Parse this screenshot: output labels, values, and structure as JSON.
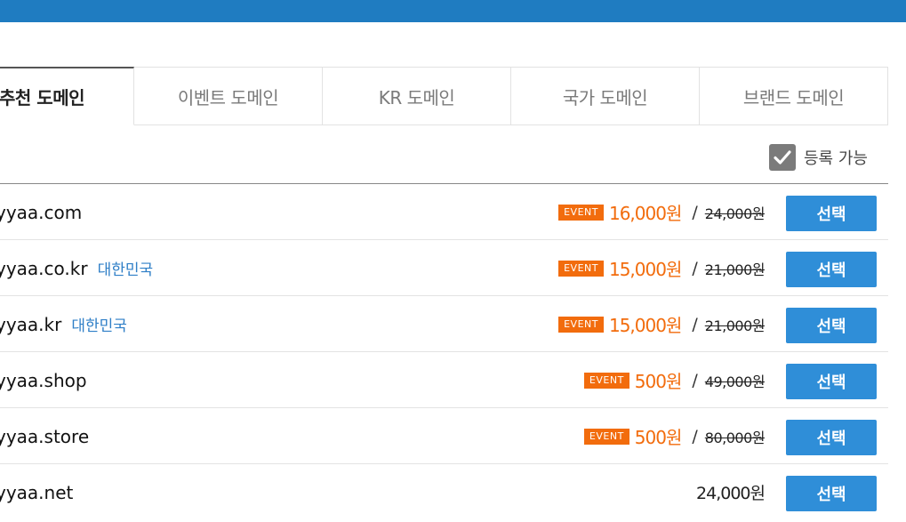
{
  "tabs": [
    {
      "label": "추천 도메인"
    },
    {
      "label": "이벤트 도메인"
    },
    {
      "label": "KR 도메인"
    },
    {
      "label": "국가 도메인"
    },
    {
      "label": "브랜드 도메인"
    }
  ],
  "filter": {
    "label": "등록 가능",
    "checked": true
  },
  "rows": [
    {
      "domain": "yyaa.com",
      "country": "",
      "badge": "EVENT",
      "price": "16,000원",
      "slash": "/",
      "original": "24,000원",
      "button": "선택"
    },
    {
      "domain": "yyaa.co.kr",
      "country": "대한민국",
      "badge": "EVENT",
      "price": "15,000원",
      "slash": "/",
      "original": "21,000원",
      "button": "선택"
    },
    {
      "domain": "yyaa.kr",
      "country": "대한민국",
      "badge": "EVENT",
      "price": "15,000원",
      "slash": "/",
      "original": "21,000원",
      "button": "선택"
    },
    {
      "domain": "yyaa.shop",
      "country": "",
      "badge": "EVENT",
      "price": "500원",
      "slash": "/",
      "original": "49,000원",
      "button": "선택"
    },
    {
      "domain": "yyaa.store",
      "country": "",
      "badge": "EVENT",
      "price": "500원",
      "slash": "/",
      "original": "80,000원",
      "button": "선택"
    },
    {
      "domain": "yyaa.net",
      "country": "",
      "price_plain": "24,000원",
      "button": "선택"
    }
  ],
  "colors": {
    "accent": "#2f8ed8",
    "topbar": "#1f7cc1",
    "event": "#f26c0d",
    "country": "#2f7fc7"
  }
}
